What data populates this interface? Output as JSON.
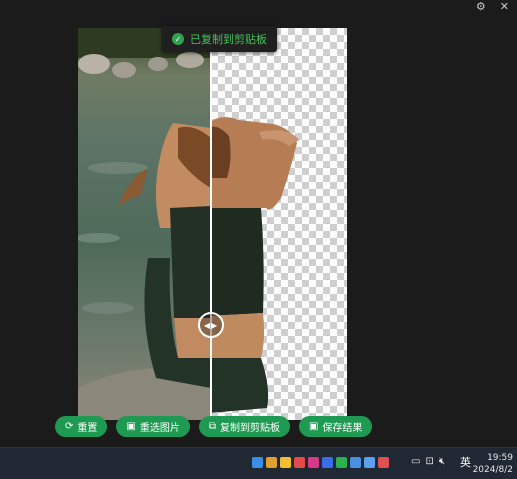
{
  "window": {
    "settings_icon": "gear-icon",
    "close_icon": "close-icon",
    "settings_glyph": "⚙",
    "close_glyph": "✕"
  },
  "toast": {
    "icon": "check-circle-icon",
    "glyph": "✓",
    "text": "已复制到剪贴板",
    "color": "#43c15a"
  },
  "compare_handle": {
    "icon": "left-right-arrows-icon",
    "glyph": "◀▶"
  },
  "actions": [
    {
      "label": "重置",
      "icon": "refresh-icon",
      "glyph": "⟳"
    },
    {
      "label": "重选图片",
      "icon": "image-icon",
      "glyph": "▣"
    },
    {
      "label": "复制到剪贴板",
      "icon": "copy-icon",
      "glyph": "⧉"
    },
    {
      "label": "保存结果",
      "icon": "save-image-icon",
      "glyph": "▣"
    }
  ],
  "accent_color": "#1f9a52",
  "taskbar": {
    "tray_icons": [
      {
        "name": "app-icon-1",
        "color": "#3a8ee6"
      },
      {
        "name": "app-icon-2",
        "color": "#e0a030"
      },
      {
        "name": "app-icon-3",
        "color": "#f0c030"
      },
      {
        "name": "app-icon-4",
        "color": "#e44a4a"
      },
      {
        "name": "app-icon-5",
        "color": "#d83a8a"
      },
      {
        "name": "app-icon-6",
        "color": "#3a6ee8"
      },
      {
        "name": "wechat-icon",
        "color": "#2bb24c"
      },
      {
        "name": "app-icon-8",
        "color": "#4a90e2"
      },
      {
        "name": "app-icon-9",
        "color": "#5aa0f0"
      },
      {
        "name": "app-icon-10",
        "color": "#e05050"
      }
    ],
    "system_icons": [
      {
        "name": "battery-icon",
        "glyph": "▭"
      },
      {
        "name": "network-icon",
        "glyph": "⊡"
      },
      {
        "name": "volume-muted-icon",
        "glyph": "🔇︎"
      }
    ],
    "ime": "英",
    "time": "19:59",
    "date": "2024/8/2"
  }
}
